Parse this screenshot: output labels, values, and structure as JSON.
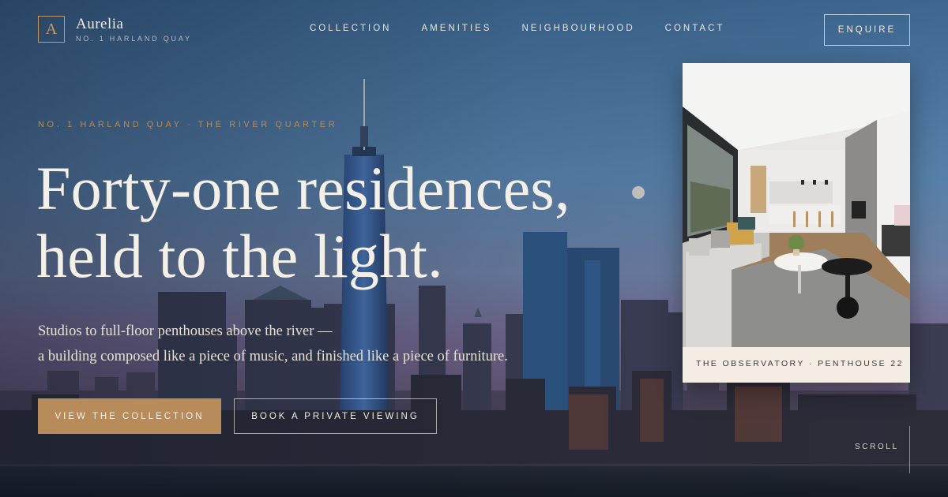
{
  "brand": {
    "monogram": "A",
    "name": "Aurelia",
    "subtitle": "NO. 1 HARLAND QUAY"
  },
  "nav": [
    "COLLECTION",
    "AMENITIES",
    "NEIGHBOURHOOD",
    "CONTACT"
  ],
  "enquire_label": "ENQUIRE",
  "hero": {
    "eyebrow": "NO. 1 HARLAND QUAY · THE RIVER QUARTER",
    "headline": [
      "Forty-one residences,",
      "held to the light."
    ],
    "subcopy": [
      "Studios to full-floor penthouses above the river —",
      "a building composed like a piece of music, and finished like a piece of furniture."
    ],
    "primary_cta": "VIEW THE COLLECTION",
    "secondary_cta": "BOOK A PRIVATE VIEWING"
  },
  "feature_card": {
    "caption": "THE OBSERVATORY · PENTHOUSE 22",
    "image": "living-room-photo"
  },
  "scroll_label": "SCROLL",
  "colors": {
    "accent": "#b88b5a",
    "sky_top": "#4f7fab",
    "sky_dusk": "#6b5a86",
    "text_light": "#f4efe7",
    "card_bg": "#f3ede3"
  }
}
